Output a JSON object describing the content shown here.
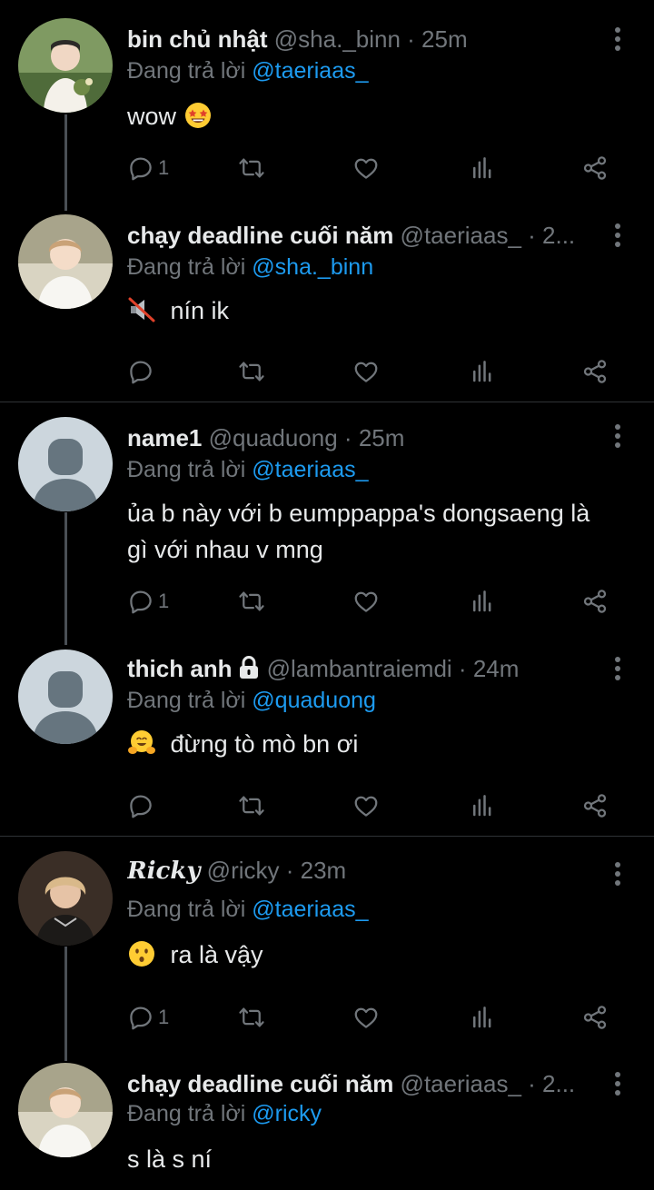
{
  "replying_prefix": "Đang trả lời",
  "tweets": [
    {
      "name": "bin chủ nhật",
      "handle": "@sha._binn",
      "sep": " · ",
      "time": "25m",
      "reply_to": "@taeriaas_",
      "text": "wow",
      "emoji": "star-struck",
      "reply_count": "1"
    },
    {
      "name": "chạy deadline cuối năm",
      "handle": "@taeriaas_",
      "sep": " · ",
      "time": "2...",
      "reply_to": "@sha._binn",
      "text": "nín ik",
      "emoji": "muted-speaker",
      "reply_count": ""
    },
    {
      "name": "name1",
      "handle": "@quaduong",
      "sep": " · ",
      "time": "25m",
      "reply_to": "@taeriaas_",
      "text_line1": "ủa b này với b eumppappa's dongsaeng là",
      "text_line2": "gì với nhau v mng",
      "reply_count": "1"
    },
    {
      "name": "thich anh",
      "handle": "@lambantraiemdi",
      "sep": " · ",
      "time": "24m",
      "reply_to": "@quaduong",
      "text": "đừng tò mò bn ơi",
      "emoji": "hugging-face",
      "reply_count": ""
    },
    {
      "name": "Ricky",
      "handle": "@ricky",
      "sep": " · ",
      "time": "23m",
      "reply_to": "@taeriaas_",
      "text": "ra là vậy",
      "emoji": "hushed-face",
      "reply_count": "1"
    },
    {
      "name": "chạy deadline cuối năm",
      "handle": "@taeriaas_",
      "sep": " · ",
      "time": "2...",
      "reply_to": "@ricky",
      "text": "s là s ní"
    }
  ],
  "colors": {
    "background": "#000000",
    "text": "#e7e9ea",
    "muted": "#71767b",
    "mention": "#1d9bf0",
    "divider": "#2f3336",
    "thread_line": "#4a4f55"
  },
  "icons": [
    "reply-icon",
    "retweet-icon",
    "like-icon",
    "views-icon",
    "share-icon",
    "more-icon",
    "lock-icon"
  ]
}
